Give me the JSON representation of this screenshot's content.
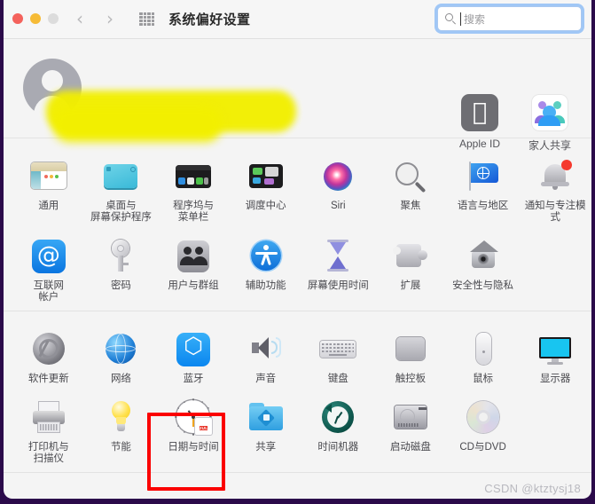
{
  "window": {
    "title": "系统偏好设置",
    "traffic_lights": [
      "close",
      "minimize",
      "zoom"
    ],
    "nav_back": "‹",
    "nav_forward": "›",
    "grid_icon": "grid-icon"
  },
  "search": {
    "placeholder": "搜索",
    "icon": "search-icon",
    "value": ""
  },
  "banner": {
    "avatar": "user-avatar",
    "redacted": true,
    "tiles": [
      {
        "label": "Apple ID",
        "icon": "apple-logo-icon"
      },
      {
        "label": "家人共享",
        "icon": "family-sharing-icon"
      }
    ]
  },
  "groups": [
    {
      "name": "personal",
      "rows": [
        [
          {
            "label": "通用",
            "icon": "general-icon"
          },
          {
            "label": "桌面与\n屏幕保护程序",
            "icon": "desktop-screensaver-icon"
          },
          {
            "label": "程序坞与\n菜单栏",
            "icon": "dock-menubar-icon"
          },
          {
            "label": "调度中心",
            "icon": "mission-control-icon"
          },
          {
            "label": "Siri",
            "icon": "siri-icon"
          },
          {
            "label": "聚焦",
            "icon": "spotlight-icon"
          },
          {
            "label": "语言与地区",
            "icon": "language-region-icon"
          },
          {
            "label": "通知与专注模式",
            "icon": "notifications-focus-icon"
          }
        ],
        [
          {
            "label": "互联网\n帐户",
            "icon": "internet-accounts-icon"
          },
          {
            "label": "密码",
            "icon": "passwords-key-icon"
          },
          {
            "label": "用户与群组",
            "icon": "users-groups-icon"
          },
          {
            "label": "辅助功能",
            "icon": "accessibility-icon"
          },
          {
            "label": "屏幕使用时间",
            "icon": "screen-time-icon"
          },
          {
            "label": "扩展",
            "icon": "extensions-puzzle-icon"
          },
          {
            "label": "安全性与隐私",
            "icon": "security-privacy-icon"
          }
        ]
      ]
    },
    {
      "name": "hardware",
      "rows": [
        [
          {
            "label": "软件更新",
            "icon": "software-update-icon"
          },
          {
            "label": "网络",
            "icon": "network-globe-icon"
          },
          {
            "label": "蓝牙",
            "icon": "bluetooth-icon"
          },
          {
            "label": "声音",
            "icon": "sound-speaker-icon"
          },
          {
            "label": "键盘",
            "icon": "keyboard-icon"
          },
          {
            "label": "触控板",
            "icon": "trackpad-icon"
          },
          {
            "label": "鼠标",
            "icon": "mouse-icon"
          },
          {
            "label": "显示器",
            "icon": "display-icon"
          }
        ],
        [
          {
            "label": "打印机与\n扫描仪",
            "icon": "printers-scanners-icon"
          },
          {
            "label": "节能",
            "icon": "energy-saver-bulb-icon"
          },
          {
            "label": "日期与时间",
            "icon": "date-time-clock-icon",
            "highlighted": true
          },
          {
            "label": "共享",
            "icon": "sharing-folder-icon"
          },
          {
            "label": "时间机器",
            "icon": "time-machine-icon"
          },
          {
            "label": "启动磁盘",
            "icon": "startup-disk-icon"
          },
          {
            "label": "CD与DVD",
            "icon": "cd-dvd-icon"
          }
        ]
      ]
    }
  ],
  "date_time_icon": {
    "month": "JUL",
    "day": "17"
  },
  "annotation": {
    "type": "highlight-rectangle",
    "color": "#fb0000",
    "target": "日期与时间"
  },
  "watermark": "CSDN @ktztysj18",
  "colors": {
    "window_bg": "#f4f4f4",
    "titlebar_bg": "#f6f6f6",
    "desktop_bg": "#2b0a4a",
    "focus_ring": "#5aa0f5",
    "annotation": "#fb0000",
    "label_text": "#4a4a4f"
  }
}
